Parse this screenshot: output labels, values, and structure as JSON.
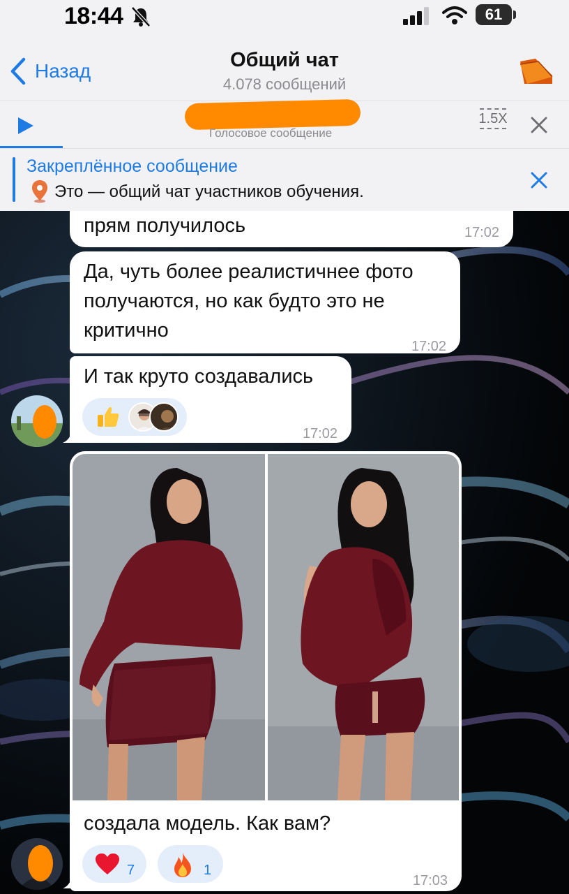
{
  "status_bar": {
    "time": "18:44",
    "battery": "61"
  },
  "header": {
    "back_label": "Назад",
    "title": "Общий чат",
    "subtitle": "4.078 сообщений"
  },
  "player": {
    "title": "Голосовое сообщение",
    "speed": "1.5X",
    "progress": 0.11
  },
  "pinned": {
    "title": "Закреплённое сообщение",
    "text": "Это — общий чат участников обучения."
  },
  "messages": [
    {
      "text": "прям получилось",
      "time": "17:02"
    },
    {
      "text": "Да, чуть более реалистичнее фото получаются, но как будто это не критично",
      "time": "17:02"
    },
    {
      "text": "И так круто создавались",
      "time": "17:02",
      "reactions": [
        {
          "emoji": "like-icon"
        }
      ]
    },
    {
      "text": "создала модель. Как вам?",
      "time": "17:03",
      "reactions": [
        {
          "emoji": "heart-icon",
          "count": "7"
        },
        {
          "emoji": "fire-icon",
          "count": "1"
        }
      ]
    }
  ],
  "colors": {
    "accent": "#1f7be4",
    "redaction": "#ff8a00",
    "bubble": "#ffffff",
    "reaction_bg": "#e4eefb",
    "outfit": "#6e1522"
  }
}
